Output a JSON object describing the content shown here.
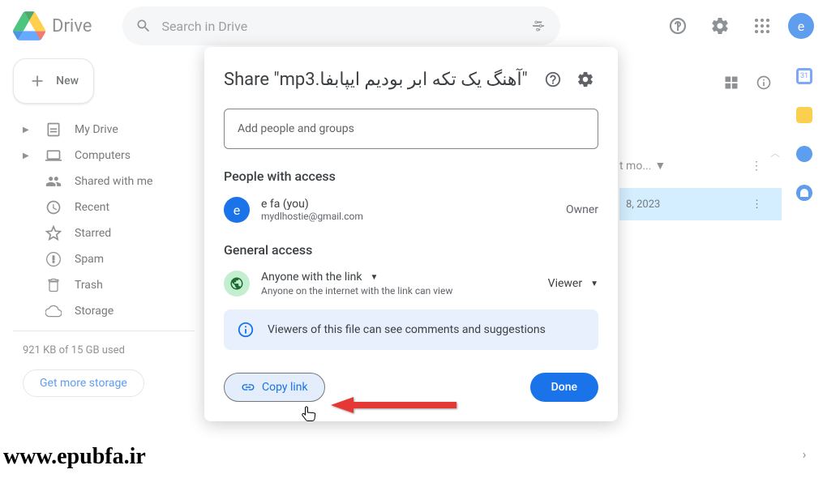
{
  "header": {
    "product": "Drive",
    "search_placeholder": "Search in Drive",
    "avatar_letter": "e"
  },
  "sidebar": {
    "new_label": "New",
    "items": [
      {
        "label": "My Drive"
      },
      {
        "label": "Computers"
      },
      {
        "label": "Shared with me"
      },
      {
        "label": "Recent"
      },
      {
        "label": "Starred"
      },
      {
        "label": "Spam"
      },
      {
        "label": "Trash"
      },
      {
        "label": "Storage"
      }
    ],
    "storage_used": "921 KB of 15 GB used",
    "storage_cta": "Get more storage"
  },
  "main": {
    "column_header": "t mo...",
    "file_date": "8, 2023"
  },
  "modal": {
    "share_prefix": "Share",
    "filename": "\"آهنگ یک تکه ابر بودیم ایپابفا.mp3\"",
    "add_placeholder": "Add people and groups",
    "people_title": "People with access",
    "owner": {
      "name": "e fa (you)",
      "email": "mydlhostie@gmail.com",
      "role": "Owner",
      "avatar_letter": "e"
    },
    "general_title": "General access",
    "access_type": "Anyone with the link",
    "access_desc": "Anyone on the internet with the link can view",
    "viewer_role": "Viewer",
    "banner_text": "Viewers of this file can see comments and suggestions",
    "copy_link": "Copy link",
    "done": "Done"
  },
  "watermark": "www.epubfa.ir"
}
